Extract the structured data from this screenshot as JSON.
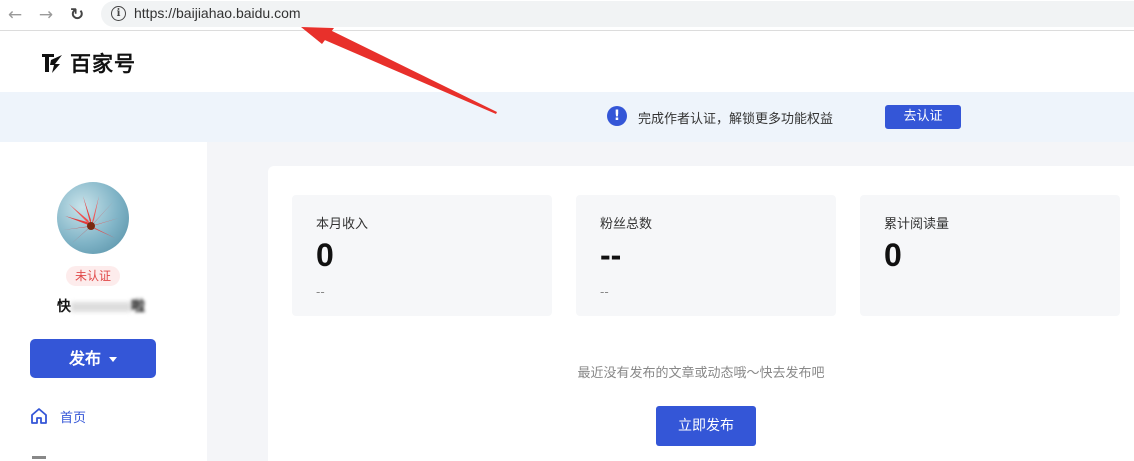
{
  "browser": {
    "back_icon": "←",
    "forward_icon": "→",
    "reload_icon": "↻",
    "url": "https://baijiahao.baidu.com"
  },
  "header": {
    "logo_text": "百家号"
  },
  "notice": {
    "text": "完成作者认证，解锁更多功能权益",
    "button_label": "去认证"
  },
  "sidebar": {
    "badge": "未认证",
    "username_prefix": "快",
    "username_suffix": "啦",
    "publish_label": "发布",
    "nav": [
      {
        "label": "首页"
      }
    ]
  },
  "stats": [
    {
      "label": "本月收入",
      "value": "0",
      "sub": "--"
    },
    {
      "label": "粉丝总数",
      "value": "--",
      "sub": "--"
    },
    {
      "label": "累计阅读量",
      "value": "0",
      "sub": ""
    }
  ],
  "main": {
    "empty_text": "最近没有发布的文章或动态哦～快去发布吧",
    "publish_now_label": "立即发布"
  },
  "colors": {
    "accent": "#3456d7",
    "notice_bg": "#eef4fb",
    "badge_text": "#e04848",
    "annotation_arrow": "#e8302b"
  }
}
